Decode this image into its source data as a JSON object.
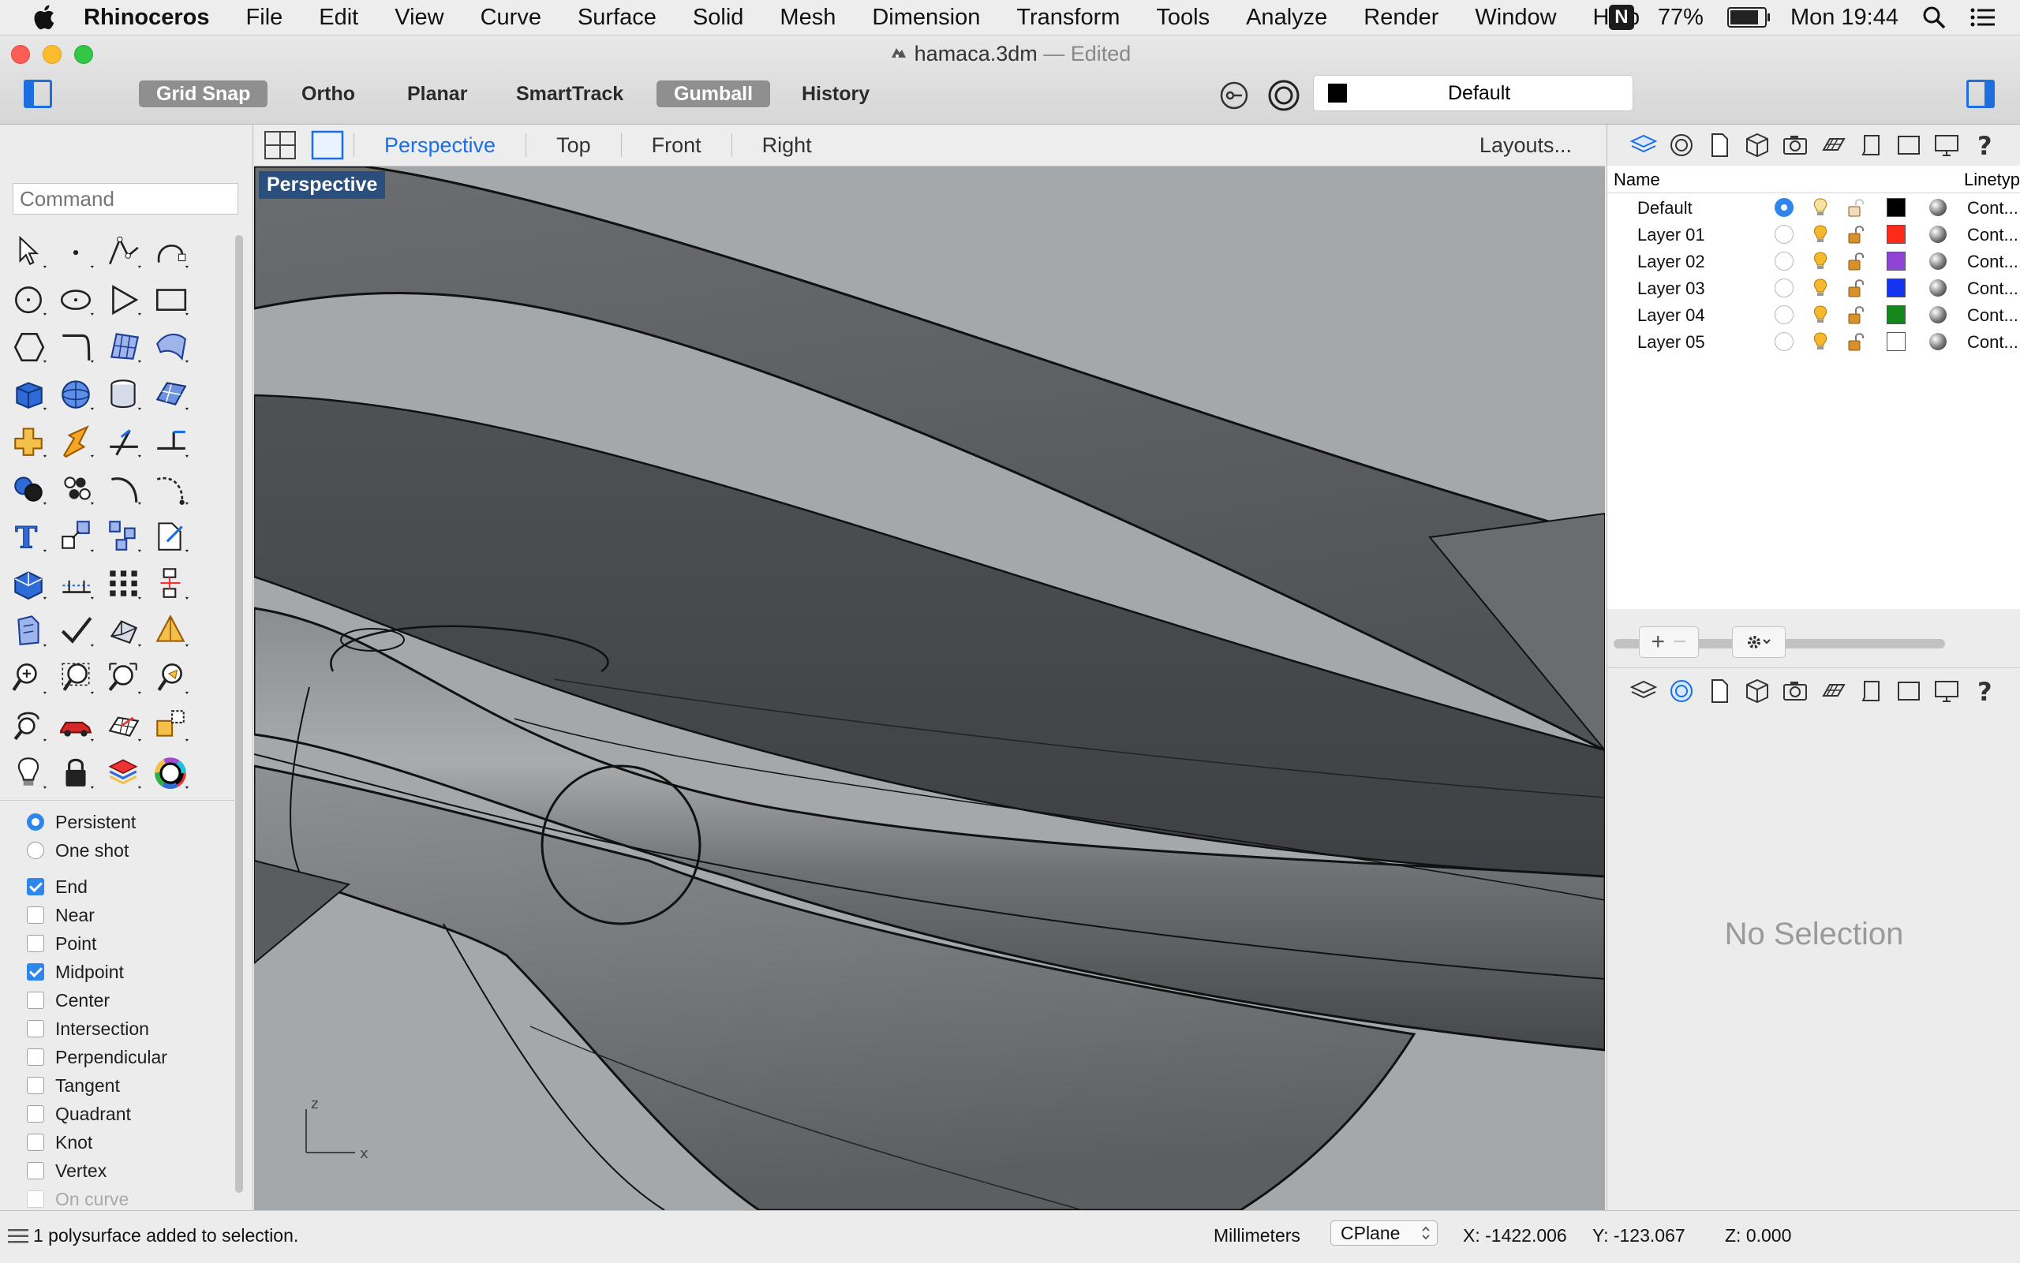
{
  "menubar": {
    "app": "Rhinoceros",
    "items": [
      "File",
      "Edit",
      "View",
      "Curve",
      "Surface",
      "Solid",
      "Mesh",
      "Dimension",
      "Transform",
      "Tools",
      "Analyze",
      "Render",
      "Window",
      "Help"
    ],
    "status": {
      "badge": "N",
      "battery": "77%",
      "battery_level": 0.77,
      "clock": "Mon 19:44"
    }
  },
  "window": {
    "title": "hamaca.3dm",
    "edited": "— Edited"
  },
  "toolbar": {
    "toggles": [
      {
        "label": "Grid Snap",
        "on": true
      },
      {
        "label": "Ortho",
        "on": false
      },
      {
        "label": "Planar",
        "on": false
      },
      {
        "label": "SmartTrack",
        "on": false
      },
      {
        "label": "Gumball",
        "on": true
      },
      {
        "label": "History",
        "on": false
      }
    ],
    "current_layer": "Default",
    "current_layer_color": "#000000"
  },
  "viewport_tabs": {
    "tabs": [
      "Perspective",
      "Top",
      "Front",
      "Right"
    ],
    "selected": "Perspective",
    "layouts": "Layouts..."
  },
  "command": {
    "placeholder": "Command"
  },
  "tool_icons": [
    "select-arrow-icon",
    "point-icon",
    "polyline-icon",
    "curve-icon",
    "circle-icon",
    "ellipse-icon",
    "polygon-icon",
    "rectangle-icon",
    "polygon-hex-icon",
    "fillet-curve-icon",
    "surface-srf-icon",
    "loft-surface-icon",
    "box-solid-icon",
    "sphere-icon",
    "cylinder-icon",
    "mesh-plane-icon",
    "explode-icon",
    "split-icon",
    "trim-icon",
    "extend-icon",
    "boolean-icon",
    "points-icon",
    "arc-icon",
    "curve-tools-icon",
    "text-icon",
    "scale-icon",
    "array-icon",
    "edit-points-icon",
    "extrude-icon",
    "dimension-icon",
    "grid-array-icon",
    "align-icon",
    "drafting-icon",
    "checkmark-icon",
    "solid-edit-icon",
    "analyze-direction-icon",
    "zoom-in-icon",
    "zoom-window-icon",
    "zoom-extents-icon",
    "zoom-selected-icon",
    "rotate-view-icon",
    "car-render-icon",
    "cplane-icon",
    "snapshot-icon",
    "light-bulb-icon",
    "lock-icon",
    "materials-icon",
    "color-wheel-icon"
  ],
  "osnap": {
    "mode": [
      {
        "label": "Persistent",
        "selected": true
      },
      {
        "label": "One shot",
        "selected": false
      }
    ],
    "snaps": [
      {
        "label": "End",
        "checked": true
      },
      {
        "label": "Near",
        "checked": false
      },
      {
        "label": "Point",
        "checked": false
      },
      {
        "label": "Midpoint",
        "checked": true
      },
      {
        "label": "Center",
        "checked": false
      },
      {
        "label": "Intersection",
        "checked": false
      },
      {
        "label": "Perpendicular",
        "checked": false
      },
      {
        "label": "Tangent",
        "checked": false
      },
      {
        "label": "Quadrant",
        "checked": false
      },
      {
        "label": "Knot",
        "checked": false
      },
      {
        "label": "Vertex",
        "checked": false
      },
      {
        "label": "On curve",
        "checked": false,
        "disabled": true
      }
    ]
  },
  "viewport": {
    "label": "Perspective",
    "axis_z": "z",
    "axis_x": "x"
  },
  "layers_panel": {
    "columns": {
      "name": "Name",
      "linetype": "Linetyp"
    },
    "rows": [
      {
        "name": "Default",
        "current": true,
        "color": "#000000",
        "linetype": "Cont..."
      },
      {
        "name": "Layer 01",
        "current": false,
        "color": "#ff2a1a",
        "linetype": "Cont..."
      },
      {
        "name": "Layer 02",
        "current": false,
        "color": "#8f44d6",
        "linetype": "Cont..."
      },
      {
        "name": "Layer 03",
        "current": false,
        "color": "#1433ee",
        "linetype": "Cont..."
      },
      {
        "name": "Layer 04",
        "current": false,
        "color": "#14881a",
        "linetype": "Cont..."
      },
      {
        "name": "Layer 05",
        "current": false,
        "color": "#ffffff",
        "linetype": "Cont..."
      }
    ],
    "add": "+",
    "remove": "−"
  },
  "properties_panel": {
    "empty_text": "No Selection"
  },
  "statusbar": {
    "message": "1 polysurface added to selection.",
    "units": "Millimeters",
    "cplane": "CPlane",
    "x": "X: -1422.006",
    "y": "Y: -123.067",
    "z": "Z: 0.000"
  }
}
